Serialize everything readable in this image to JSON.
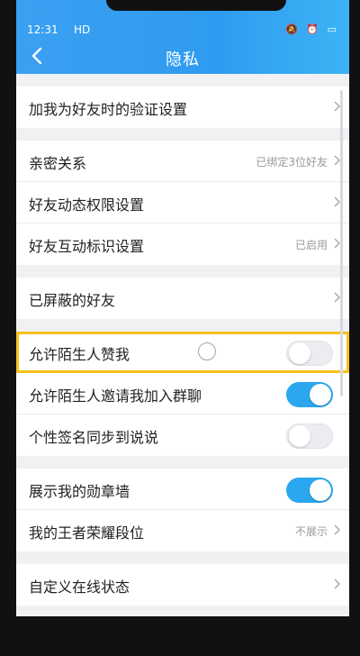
{
  "statusbar": {
    "time": "12:31",
    "network": "HD",
    "icons": [
      "mute-icon",
      "alarm-icon",
      "battery-icon"
    ]
  },
  "header": {
    "title": "隐私",
    "back_icon": "chevron-left-icon"
  },
  "groups": [
    {
      "rows": [
        {
          "label": "加我为好友时的验证设置",
          "type": "nav"
        }
      ]
    },
    {
      "rows": [
        {
          "label": "亲密关系",
          "type": "nav",
          "value": "已绑定3位好友"
        },
        {
          "label": "好友动态权限设置",
          "type": "nav"
        },
        {
          "label": "好友互动标识设置",
          "type": "nav",
          "value": "已启用"
        }
      ]
    },
    {
      "rows": [
        {
          "label": "已屏蔽的好友",
          "type": "nav"
        }
      ]
    },
    {
      "rows": [
        {
          "label": "允许陌生人赞我",
          "type": "toggle",
          "on": false
        },
        {
          "label": "允许陌生人邀请我加入群聊",
          "type": "toggle",
          "on": true
        },
        {
          "label": "个性签名同步到说说",
          "type": "toggle",
          "on": false
        }
      ]
    },
    {
      "rows": [
        {
          "label": "展示我的勋章墙",
          "type": "toggle",
          "on": true
        },
        {
          "label": "我的王者荣耀段位",
          "type": "nav",
          "value": "不展示"
        }
      ]
    },
    {
      "rows": [
        {
          "label": "自定义在线状态",
          "type": "nav"
        }
      ]
    }
  ],
  "colors": {
    "accent": "#2aa7ef",
    "header": "#2f9bf0",
    "highlight": "#f7c21e"
  }
}
